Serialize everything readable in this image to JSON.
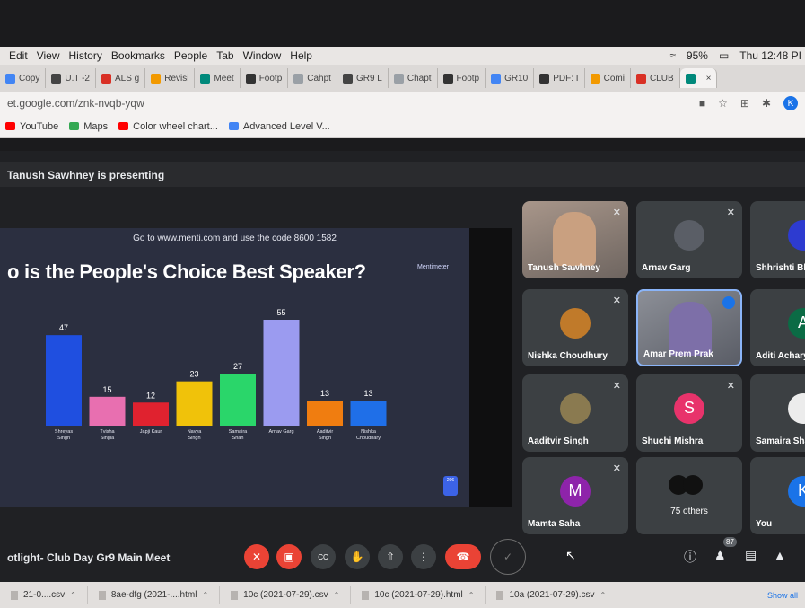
{
  "menubar": {
    "items": [
      "Edit",
      "View",
      "History",
      "Bookmarks",
      "People",
      "Tab",
      "Window",
      "Help"
    ],
    "battery": "95%",
    "clock": "Thu 12:48 PI"
  },
  "tabs": [
    {
      "label": "Copy",
      "color": "#4285f4"
    },
    {
      "label": "U.T -2",
      "color": "#444444"
    },
    {
      "label": "ALS g",
      "color": "#d93025"
    },
    {
      "label": "Revisi",
      "color": "#f29900"
    },
    {
      "label": "Meet",
      "color": "#00897b"
    },
    {
      "label": "Footp",
      "color": "#333333"
    },
    {
      "label": "Cahpt",
      "color": "#9aa0a6"
    },
    {
      "label": "GR9 L",
      "color": "#444444"
    },
    {
      "label": "Chapt",
      "color": "#9aa0a6"
    },
    {
      "label": "Footp",
      "color": "#333333"
    },
    {
      "label": "GR10",
      "color": "#4285f4"
    },
    {
      "label": "PDF: I",
      "color": "#333333"
    },
    {
      "label": "Comi",
      "color": "#f29900"
    },
    {
      "label": "CLUB",
      "color": "#d93025"
    },
    {
      "label": "",
      "color": "#00897b"
    }
  ],
  "address": {
    "url": "et.google.com/znk-nvqb-yqw",
    "profile_initial": "K"
  },
  "bookmarks": [
    {
      "label": "YouTube",
      "color": "#ff0000"
    },
    {
      "label": "Maps",
      "color": "#34a853"
    },
    {
      "label": "Color wheel chart...",
      "color": "#ff0000"
    },
    {
      "label": "Advanced Level V...",
      "color": "#4285f4"
    }
  ],
  "meet": {
    "presenting_text": "Tanush Sawhney is presenting",
    "meeting_name": "otlight- Club Day Gr9 Main Meet",
    "people_count": "87"
  },
  "slide": {
    "code_line": "Go to www.menti.com and use the code 8600 1582",
    "title": "o is the People's Choice Best Speaker?",
    "brand": "Mentimeter",
    "responses": "206"
  },
  "chart_data": {
    "type": "bar",
    "title": "o is the People's Choice Best Speaker?",
    "categories": [
      "Shreyas Singh",
      "Tvisha Singla",
      "Japji Kaur",
      "Navya Singh",
      "Samaira Shah",
      "Arnav Garg",
      "Aaditvir Singh",
      "Nishka Choudhary"
    ],
    "category_lines": [
      [
        "Shreyas",
        "Singh"
      ],
      [
        "Tvisha",
        "Singla"
      ],
      [
        "Japji Kaur"
      ],
      [
        "Navya",
        "Singh"
      ],
      [
        "Samaira",
        "Shah"
      ],
      [
        "Arnav Garg"
      ],
      [
        "Aaditvir",
        "Singh"
      ],
      [
        "Nishka",
        "Choudhary"
      ]
    ],
    "values": [
      47,
      15,
      12,
      23,
      27,
      55,
      13,
      13
    ],
    "colors": [
      "#1f4fe0",
      "#e86fb0",
      "#e0222f",
      "#f0c20a",
      "#2ad66a",
      "#9b9bf0",
      "#f07d10",
      "#1f6fe8"
    ],
    "ylim": [
      0,
      55
    ],
    "grid": false,
    "xlabel": "",
    "ylabel": ""
  },
  "participants": [
    {
      "name": "Tanush Sawhney",
      "type": "video",
      "muted": true
    },
    {
      "name": "Arnav Garg",
      "type": "photo",
      "muted": true,
      "bg": "#5a5e66"
    },
    {
      "name": "Shhrishti Bh",
      "type": "photo",
      "muted": false,
      "bg": "#2d3bd0"
    },
    {
      "name": "Nishka Choudhury",
      "type": "photo",
      "muted": true,
      "bg": "#c07a2a"
    },
    {
      "name": "Amar Prem Prak",
      "type": "video",
      "muted": false
    },
    {
      "name": "Aditi Acharya",
      "initial": "A",
      "type": "initial",
      "muted": false,
      "bg": "#0b6b45"
    },
    {
      "name": "Aaditvir Singh",
      "type": "photo",
      "muted": true,
      "bg": "#8a7a50"
    },
    {
      "name": "Shuchi Mishra",
      "initial": "S",
      "type": "initial",
      "muted": true,
      "bg": "#e8336b"
    },
    {
      "name": "Samaira Shah",
      "type": "photo",
      "muted": false,
      "bg": "#ececec"
    },
    {
      "name": "Mamta Saha",
      "initial": "M",
      "type": "initial",
      "muted": true,
      "bg": "#8e24aa"
    },
    {
      "name": "75 others",
      "type": "others",
      "muted": false
    },
    {
      "name": "You",
      "initial": "K",
      "type": "initial",
      "muted": false,
      "bg": "#1a73e8"
    }
  ],
  "downloads": [
    {
      "label": "21-0....csv"
    },
    {
      "label": "8ae-dfg (2021-....html"
    },
    {
      "label": "10c (2021-07-29).csv"
    },
    {
      "label": "10c (2021-07-29).html"
    },
    {
      "label": "10a (2021-07-29).csv"
    }
  ],
  "downloads_show_all": "Show all"
}
